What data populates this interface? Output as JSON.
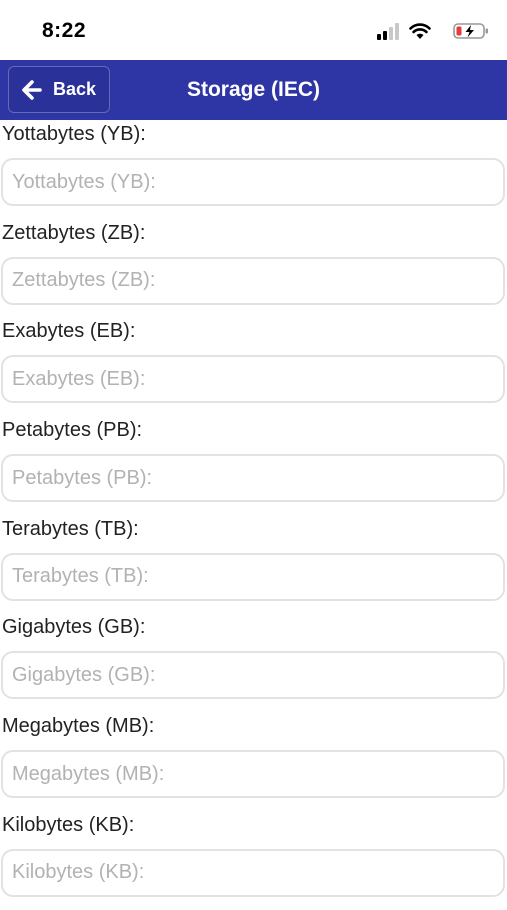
{
  "status_bar": {
    "time": "8:22",
    "icons": [
      "signal-icon",
      "wifi-icon",
      "battery-low-charging-icon"
    ]
  },
  "nav": {
    "back_label": "Back",
    "title": "Storage (IEC)",
    "background_color": "#2e35a4"
  },
  "fields": [
    {
      "label": "Yottabytes (YB):",
      "placeholder": "Yottabytes (YB):",
      "value": ""
    },
    {
      "label": "Zettabytes (ZB):",
      "placeholder": "Zettabytes (ZB):",
      "value": ""
    },
    {
      "label": "Exabytes (EB):",
      "placeholder": "Exabytes (EB):",
      "value": ""
    },
    {
      "label": "Petabytes (PB):",
      "placeholder": "Petabytes (PB):",
      "value": ""
    },
    {
      "label": "Terabytes (TB):",
      "placeholder": "Terabytes (TB):",
      "value": ""
    },
    {
      "label": "Gigabytes (GB):",
      "placeholder": "Gigabytes (GB):",
      "value": ""
    },
    {
      "label": "Megabytes (MB):",
      "placeholder": "Megabytes (MB):",
      "value": ""
    },
    {
      "label": "Kilobytes (KB):",
      "placeholder": "Kilobytes (KB):",
      "value": ""
    }
  ]
}
